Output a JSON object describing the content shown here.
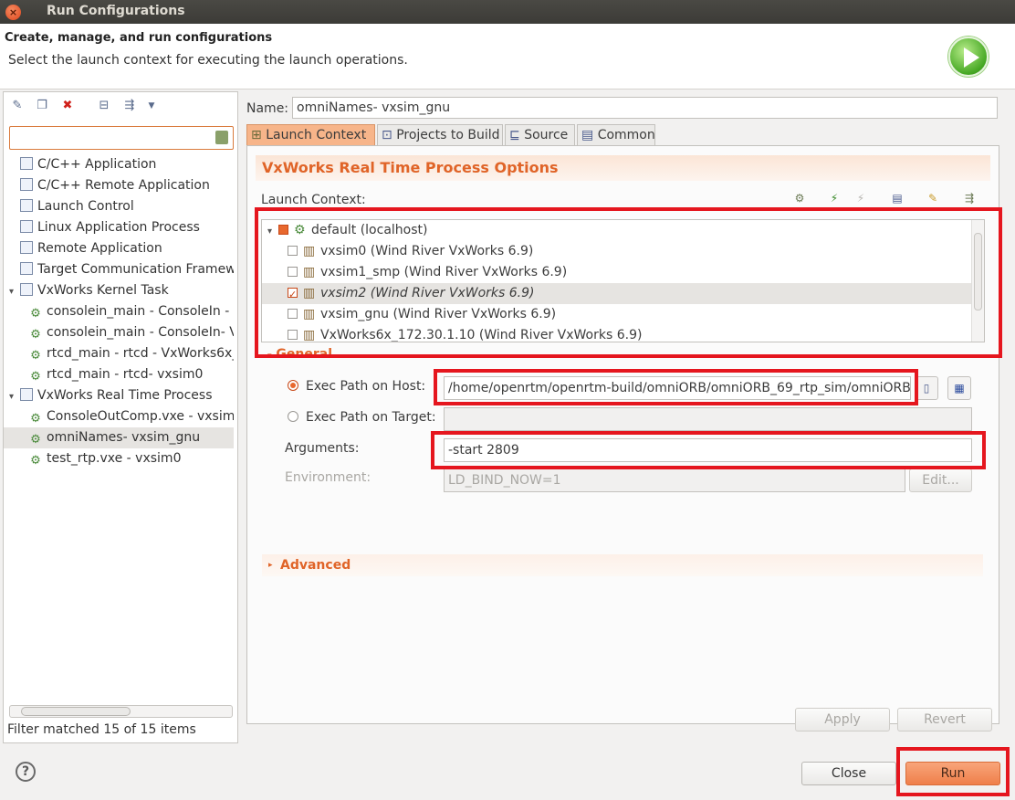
{
  "window": {
    "title": "Run Configurations"
  },
  "header": {
    "title": "Create, manage, and run configurations",
    "message": "Select the launch context for executing the launch operations."
  },
  "sidebar": {
    "filter_value": "",
    "items": [
      {
        "label": "C/C++ Application",
        "level": 0
      },
      {
        "label": "C/C++ Remote Application",
        "level": 0
      },
      {
        "label": "Launch Control",
        "level": 0
      },
      {
        "label": "Linux Application Process",
        "level": 0
      },
      {
        "label": "Remote Application",
        "level": 0
      },
      {
        "label": "Target Communication Framewo",
        "level": 0
      },
      {
        "label": "VxWorks Kernel Task",
        "level": 0,
        "expanded": true
      },
      {
        "label": "consolein_main - ConsoleIn - vx",
        "level": 1
      },
      {
        "label": "consolein_main - ConsoleIn- Vx",
        "level": 1
      },
      {
        "label": "rtcd_main - rtcd - VxWorks6x_",
        "level": 1
      },
      {
        "label": "rtcd_main - rtcd- vxsim0",
        "level": 1
      },
      {
        "label": "VxWorks Real Time Process",
        "level": 0,
        "expanded": true
      },
      {
        "label": "ConsoleOutComp.vxe - vxsim_",
        "level": 1
      },
      {
        "label": "omniNames- vxsim_gnu",
        "level": 1,
        "selected": true
      },
      {
        "label": "test_rtp.vxe - vxsim0",
        "level": 1
      }
    ],
    "status": "Filter matched 15 of 15 items"
  },
  "config": {
    "name_label": "Name:",
    "name_value": "omniNames- vxsim_gnu",
    "tabs": [
      "Launch Context",
      "Projects to Build",
      "Source",
      "Common"
    ],
    "section_title": "VxWorks Real Time Process Options",
    "launch_context_label": "Launch Context:",
    "contexts": [
      {
        "label": "default (localhost)",
        "root": true
      },
      {
        "label": "vxsim0 (Wind River VxWorks 6.9)",
        "checked": false
      },
      {
        "label": "vxsim1_smp (Wind River VxWorks 6.9)",
        "checked": false
      },
      {
        "label": "vxsim2 (Wind River VxWorks 6.9)",
        "checked": true,
        "selected": true
      },
      {
        "label": "vxsim_gnu (Wind River VxWorks 6.9)",
        "checked": false
      },
      {
        "label": "VxWorks6x_172.30.1.10 (Wind River VxWorks 6.9)",
        "checked": false
      }
    ],
    "general_label": "General",
    "exec_host_label": "Exec Path on Host:",
    "exec_host_value": "/home/openrtm/openrtm-build/omniORB/omniORB_69_rtp_sim/omniORB",
    "exec_target_label": "Exec Path on Target:",
    "exec_target_value": "",
    "arguments_label": "Arguments:",
    "arguments_value": "-start 2809",
    "environment_label": "Environment:",
    "environment_value": "LD_BIND_NOW=1",
    "edit_label": "Edit...",
    "advanced_label": "Advanced",
    "apply_label": "Apply",
    "revert_label": "Revert"
  },
  "footer": {
    "help_label": "?",
    "close_label": "Close",
    "run_label": "Run"
  },
  "colors": {
    "accent": "#e06428",
    "highlight": "#e5161e",
    "run_button": "#ef7f4a"
  }
}
